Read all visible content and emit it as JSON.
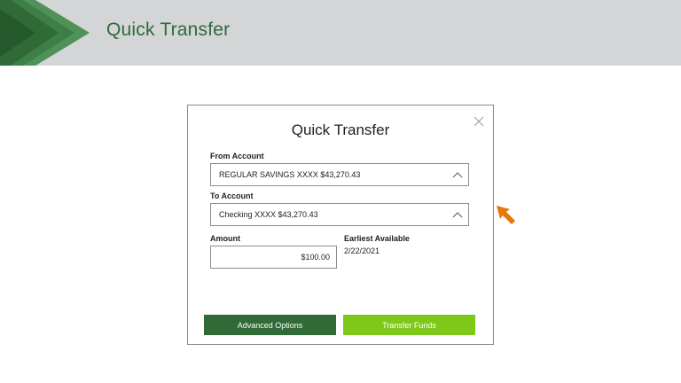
{
  "banner": {
    "title": "Quick Transfer"
  },
  "dialog": {
    "title": "Quick Transfer",
    "from_account": {
      "label": "From Account",
      "value": "REGULAR SAVINGS XXXX $43,270.43"
    },
    "to_account": {
      "label": "To Account",
      "value": "Checking XXXX $43,270.43"
    },
    "amount": {
      "label": "Amount",
      "value": "$100.00"
    },
    "earliest_available": {
      "label": "Earliest Available",
      "value": "2/22/2021"
    },
    "buttons": {
      "advanced": "Advanced Options",
      "transfer": "Transfer Funds"
    }
  },
  "icons": {
    "close": "close-icon",
    "chevron": "chevron-up-icon",
    "pointer": "arrow-pointer-icon"
  },
  "colors": {
    "banner_bg": "#d4d5d6",
    "brand_dark_green": "#2f6a37",
    "brand_light_green": "#7ec81a",
    "pointer_orange": "#e8760f"
  }
}
